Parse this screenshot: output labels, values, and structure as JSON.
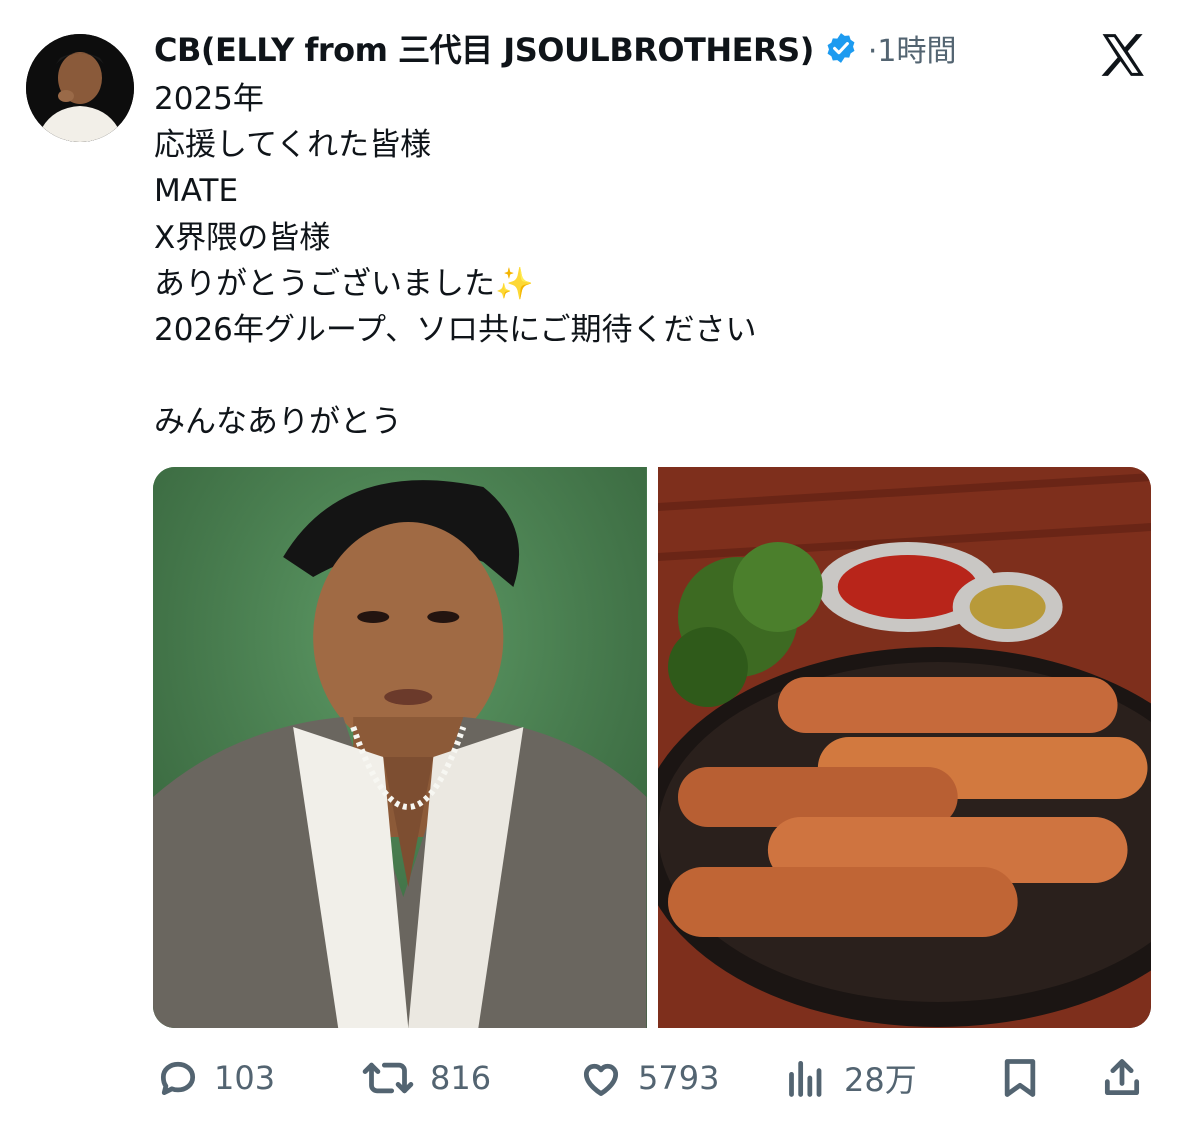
{
  "author": {
    "name": "CB(ELLY from 三代目 JSOULBROTHERS)",
    "timestamp": "1時間"
  },
  "post": {
    "text": "2025年\n応援してくれた皆様\nMATE\nX界隈の皆様\nありがとうございました✨\n2026年グループ、ソロ共にご期待ください\n\nみんなありがとう"
  },
  "media": [
    {
      "name": "portrait-photo"
    },
    {
      "name": "sausage-photo"
    }
  ],
  "actions": {
    "replies": "103",
    "reposts": "816",
    "likes": "5793",
    "views": "28万"
  },
  "colors": {
    "verified": "#1d9bf0",
    "muted": "#536471",
    "text": "#0f1419"
  }
}
